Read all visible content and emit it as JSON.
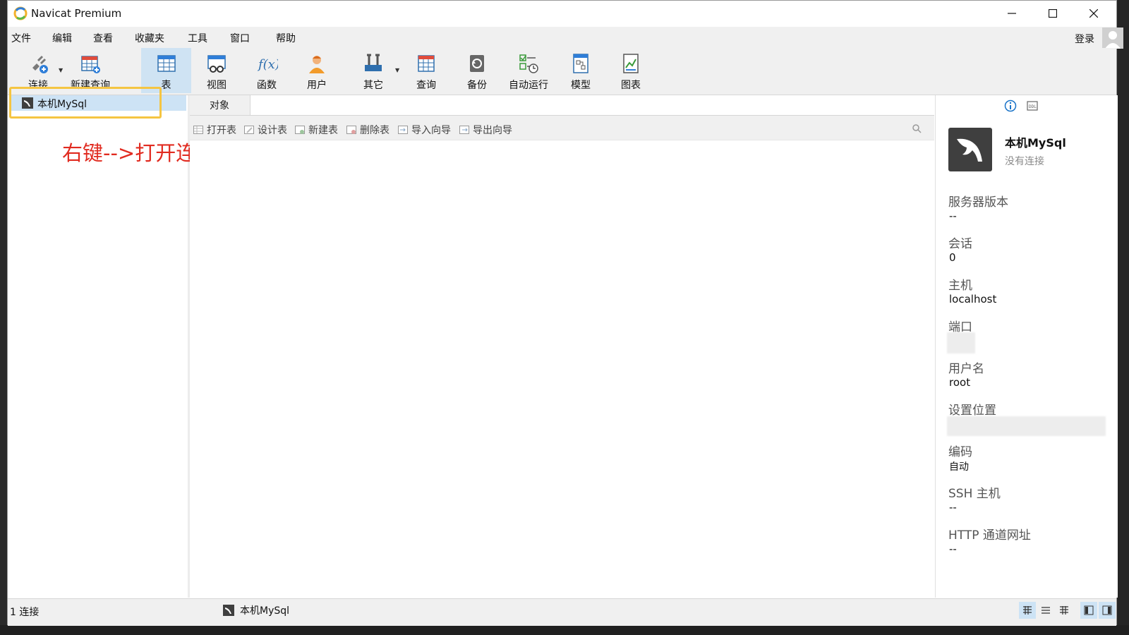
{
  "window": {
    "title": "Navicat Premium"
  },
  "menu": {
    "items": [
      "文件",
      "编辑",
      "查看",
      "收藏夹",
      "工具",
      "窗口",
      "帮助"
    ],
    "login": "登录"
  },
  "toolbar": {
    "connect": "连接",
    "new_query": "新建查询",
    "table": "表",
    "view": "视图",
    "function": "函数",
    "user": "用户",
    "other": "其它",
    "query": "查询",
    "backup": "备份",
    "automation": "自动运行",
    "model": "模型",
    "chart": "图表"
  },
  "tree": {
    "connection_name": "本机MySql"
  },
  "annotation": "右键-->打开连接",
  "tabs": {
    "objects": "对象"
  },
  "object_toolbar": {
    "open_table": "打开表",
    "design_table": "设计表",
    "new_table": "新建表",
    "delete_table": "删除表",
    "import_wizard": "导入向导",
    "export_wizard": "导出向导"
  },
  "info_panel": {
    "name": "本机MySql",
    "status": "没有连接",
    "server_version_label": "服务器版本",
    "server_version": "--",
    "session_label": "会话",
    "session": "0",
    "host_label": "主机",
    "host": "localhost",
    "port_label": "端口",
    "username_label": "用户名",
    "username": "root",
    "settings_location_label": "设置位置",
    "encoding_label": "编码",
    "encoding": "自动",
    "ssh_host_label": "SSH 主机",
    "ssh_host": "--",
    "http_tunnel_label": "HTTP 通道网址",
    "http_tunnel": "--"
  },
  "statusbar": {
    "connections": "1 连接",
    "current": "本机MySql"
  },
  "colors": {
    "accent": "#1a73c8",
    "selection": "#cde3f5",
    "annotation": "#e12b20",
    "highlight_box": "#f5c542"
  }
}
